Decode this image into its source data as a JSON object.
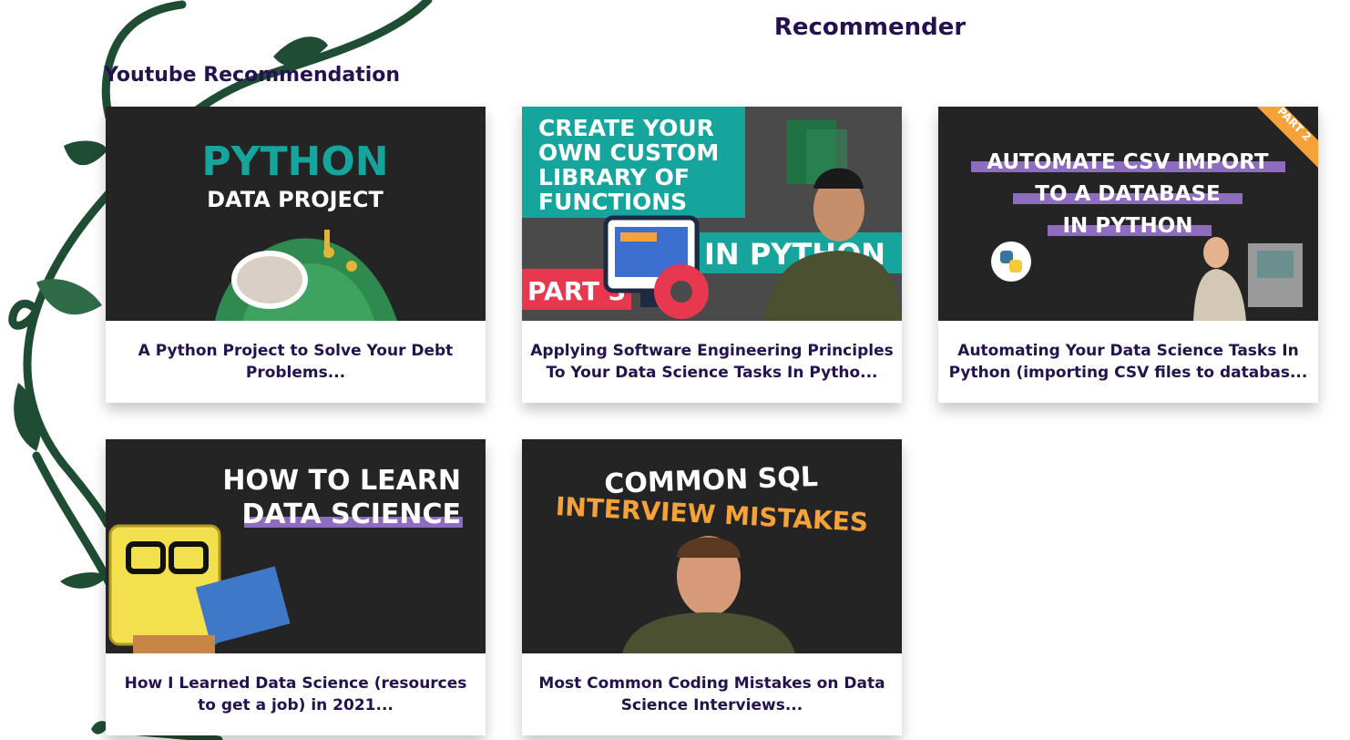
{
  "page": {
    "title": "Recommender"
  },
  "section": {
    "title": "Youtube Recommendation"
  },
  "videos": [
    {
      "title": "A Python Project to Solve Your Debt Problems...",
      "thumb": {
        "line1": "PYTHON",
        "line2": "DATA PROJECT"
      }
    },
    {
      "title": "Applying Software Engineering Principles To Your Data Science Tasks In Pytho...",
      "thumb": {
        "line1": "CREATE YOUR",
        "line2": "OWN CUSTOM",
        "line3": "LIBRARY OF",
        "line4": "FUNCTIONS",
        "line5": "IN PYTHON",
        "line6": "PART 3"
      }
    },
    {
      "title": "Automating Your Data Science Tasks In Python (importing CSV files to databas...",
      "thumb": {
        "line1": "AUTOMATE CSV IMPORT",
        "line2": "TO A DATABASE",
        "line3": "IN PYTHON",
        "badge": "PART 2"
      }
    },
    {
      "title": "How I Learned Data Science (resources to get a job) in 2021...",
      "thumb": {
        "line1": "HOW TO LEARN",
        "line2": "DATA SCIENCE"
      }
    },
    {
      "title": "Most Common Coding Mistakes on Data Science Interviews...",
      "thumb": {
        "line1": "COMMON SQL",
        "line2": "INTERVIEW MISTAKES"
      }
    }
  ],
  "colors": {
    "heading": "#24124f",
    "vine": "#1f4d33",
    "thumb_bg": "#242424",
    "teal": "#16a59c",
    "purple": "#8e6cc0",
    "orange": "#f5a23b"
  }
}
